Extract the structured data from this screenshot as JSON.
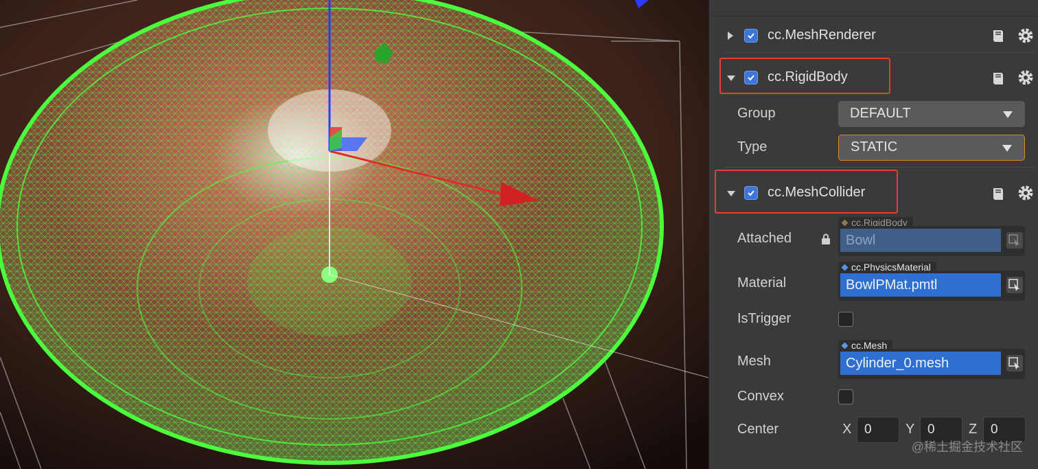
{
  "inspector": {
    "components": [
      {
        "name": "cc.MeshRenderer",
        "expanded": false,
        "enabled": true
      },
      {
        "name": "cc.RigidBody",
        "expanded": true,
        "enabled": true,
        "highlighted": true
      },
      {
        "name": "cc.MeshCollider",
        "expanded": true,
        "enabled": true,
        "highlighted": true
      }
    ],
    "rigidbody": {
      "group_label": "Group",
      "group_value": "DEFAULT",
      "type_label": "Type",
      "type_value": "STATIC"
    },
    "meshcollider": {
      "attached_label": "Attached",
      "attached_type": "cc.RigidBody",
      "attached_value": "Bowl",
      "material_label": "Material",
      "material_type": "cc.PhysicsMaterial",
      "material_value": "BowlPMat.pmtl",
      "istrigger_label": "IsTrigger",
      "istrigger_checked": false,
      "mesh_label": "Mesh",
      "mesh_type": "cc.Mesh",
      "mesh_value": "Cylinder_0.mesh",
      "convex_label": "Convex",
      "convex_checked": false,
      "center_label": "Center",
      "center": {
        "x_label": "X",
        "x": "0",
        "y_label": "Y",
        "y": "0",
        "z_label": "Z",
        "z": "0"
      }
    }
  },
  "watermark": "@稀土掘金技术社区",
  "colors": {
    "highlight": "#e8402c",
    "wireframe": "#4cff3c",
    "accent_blue": "#2f6fd0",
    "panel_bg": "#3a3a3a"
  },
  "icons": [
    "expand-arrow-icon",
    "checkbox-icon",
    "book-icon",
    "gear-icon",
    "lock-icon",
    "picker-icon"
  ]
}
